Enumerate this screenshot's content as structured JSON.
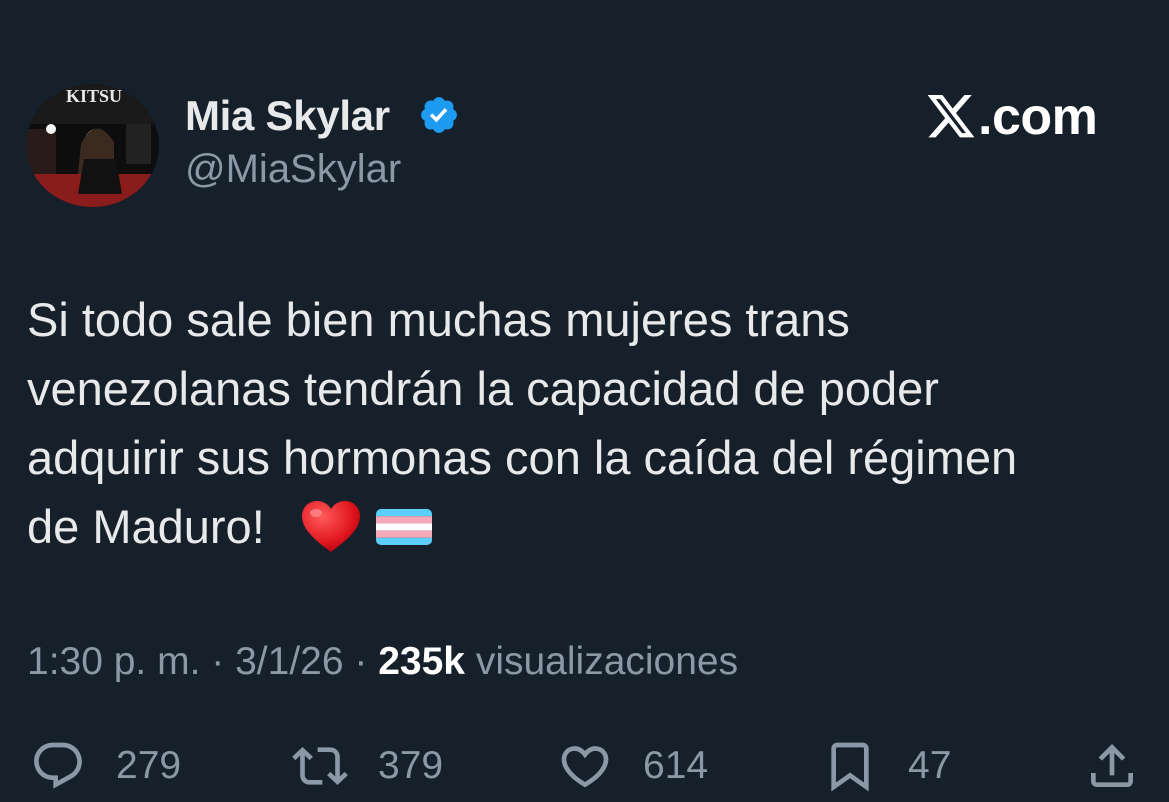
{
  "author": {
    "display_name": "Mia Skylar",
    "handle": "@MiaSkylar",
    "verified": true,
    "avatar_text": "KITSU"
  },
  "brand": {
    "logo_icon": "x-logo-icon",
    "text": ".com"
  },
  "tweet": {
    "text": "Si todo sale bien muchas mujeres trans\nvenezolanas tendrán la capacidad de poder\nadquirir sus hormonas con la caída del régimen\nde Maduro!",
    "emojis": [
      "red-heart-emoji",
      "transgender-flag-emoji"
    ]
  },
  "meta": {
    "time": "1:30 p. m.",
    "separator": " · ",
    "date": "3/1/26",
    "views_count": "235k",
    "views_label": "visualizaciones"
  },
  "actions": {
    "replies": "279",
    "reposts": "379",
    "likes": "614",
    "bookmarks": "47"
  },
  "colors": {
    "background": "#15202b",
    "primary_text": "#e7e9ea",
    "secondary_text": "#8b98a5",
    "verified_blue": "#1d9bf0"
  }
}
